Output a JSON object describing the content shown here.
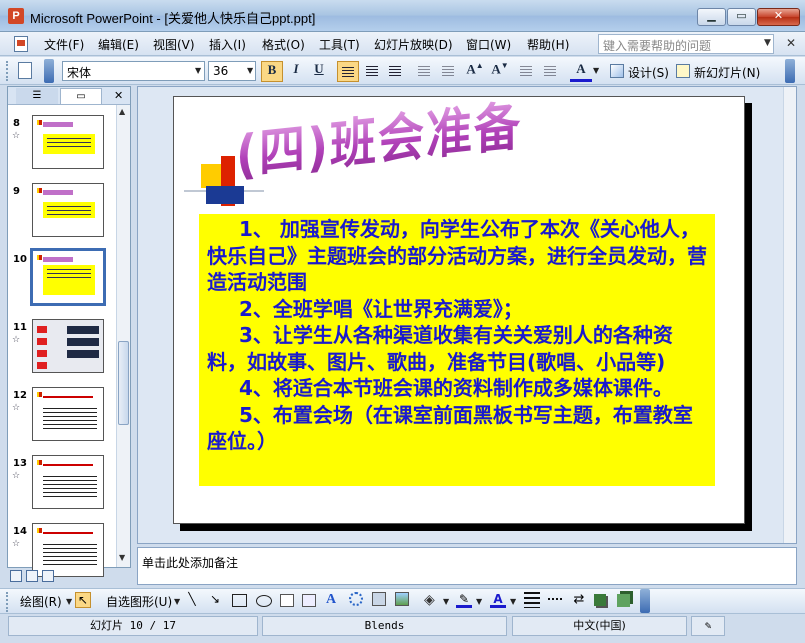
{
  "window": {
    "title": "Microsoft PowerPoint - [关爱他人快乐自己ppt.ppt]",
    "app_icon": "P"
  },
  "menu": {
    "items": [
      "文件(F)",
      "编辑(E)",
      "视图(V)",
      "插入(I)",
      "格式(O)",
      "工具(T)",
      "幻灯片放映(D)",
      "窗口(W)",
      "帮助(H)"
    ],
    "help_placeholder": "键入需要帮助的问题"
  },
  "toolbar": {
    "font_name": "宋体",
    "font_size": "36",
    "bold": "B",
    "italic": "I",
    "underline": "U",
    "design_label": "设计(S)",
    "new_slide_label": "新幻灯片(N)"
  },
  "slides_pane": {
    "slides": [
      {
        "number": "8",
        "has_transition": true
      },
      {
        "number": "9",
        "has_transition": false
      },
      {
        "number": "10",
        "has_transition": false,
        "selected": true
      },
      {
        "number": "11",
        "has_transition": true
      },
      {
        "number": "12",
        "has_transition": true
      },
      {
        "number": "13",
        "has_transition": true
      },
      {
        "number": "14",
        "has_transition": true
      }
    ]
  },
  "slide": {
    "title": "(四)班会准备",
    "paragraphs": [
      "1、 加强宣传发动，向学生公布了本次《关心他人，快乐自己》主题班会的部分活动方案，进行全员发动，营造活动范围",
      "2、全班学唱《让世界充满爱》；",
      "3、让学生从各种渠道收集有关关爱别人的各种资料，如故事、图片、歌曲，准备节目(歌唱、小品等)",
      "4、将适合本节班会课的资料制作成多媒体课件。",
      "5、布置会场（在课室前面黑板书写主题，布置教室座位。）"
    ],
    "colors": {
      "box": "#ffff00",
      "text": "#1a1acd",
      "title": "#b540b8"
    }
  },
  "notes": {
    "placeholder": "单击此处添加备注"
  },
  "draw_toolbar": {
    "draw_label": "绘图(R)",
    "autoshapes_label": "自选图形(U)"
  },
  "status": {
    "slide_info": "幻灯片 10 / 17",
    "design": "Blends",
    "language": "中文(中国)"
  }
}
